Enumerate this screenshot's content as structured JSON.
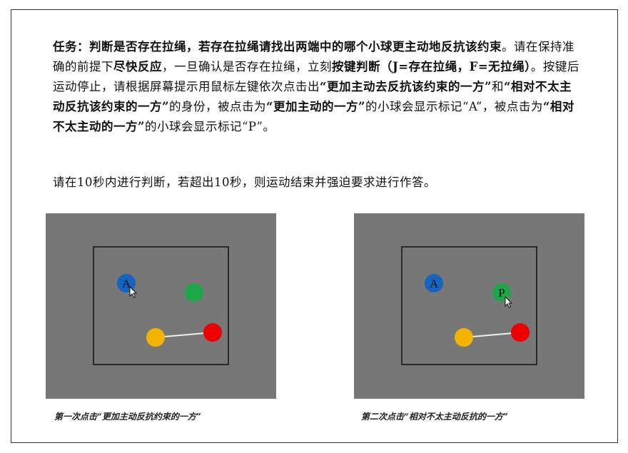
{
  "instructions": {
    "p1_bold1": "任务：判断是否存在拉绳，若存在拉绳请找出两端中的哪个小球更主动地反抗该约束",
    "p1_t1": "。请在保持准确的前提下",
    "p1_bold2": "尽快反应",
    "p1_t2": "，一旦确认是否存在拉绳，立刻",
    "p1_bold3": "按键判断",
    "p1_bold4": "（J=存在拉绳，F=无拉绳）",
    "p1_t3": "。按键后运动停止，请根据屏幕提示用鼠标左键依次点击出",
    "p1_bold5": "“更加主动去反抗该约束的一方”",
    "p1_t4": "和",
    "p1_bold6": "“相对不太主动反抗该约束的一方”",
    "p1_t5": "的身份，被点击为",
    "p1_bold7": "“更加主动的一方”",
    "p1_t6": "的小球会显示标记“A”，被点击为",
    "p1_bold8": "“相对不太主动的一方”",
    "p1_t7": "的小球会显示标记“P”。",
    "p2": "请在10秒内进行判断，若超出10秒，则运动结束并强迫要求进行作答。"
  },
  "panels": [
    {
      "caption": "第一次点击“更加主动反抗约束的一方”",
      "label_a": "A",
      "label_p": ""
    },
    {
      "caption": "第二次点击“相对不太主动反抗的一方”",
      "label_a": "A",
      "label_p": "P"
    }
  ],
  "colors": {
    "panel_bg": "#777777",
    "blue": "#1565c0",
    "green": "#1fa64a",
    "yellow": "#f5b400",
    "red": "#ee0000",
    "rope": "#f0f0f0",
    "inner_border": "#111111"
  },
  "icons": [
    "mouse-cursor-icon"
  ]
}
